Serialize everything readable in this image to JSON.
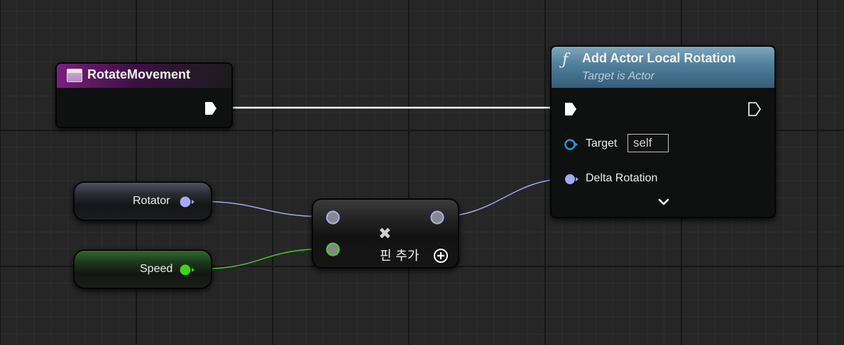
{
  "graph": {
    "background": "#262626",
    "event_node": {
      "title": "RotateMovement",
      "icon": "custom-event-icon",
      "header_color": "#7a1f7e"
    },
    "function_node": {
      "icon": "function-icon",
      "icon_glyph": "ƒ",
      "title": "Add Actor Local Rotation",
      "subtitle": "Target is Actor",
      "header_color": "#4f7d9a",
      "pins": {
        "target_label": "Target",
        "target_default": "self",
        "delta_label": "Delta Rotation"
      },
      "expand_icon": "chevron-down-icon"
    },
    "rotator_var": {
      "label": "Rotator",
      "pin_color": "#a3aaf2"
    },
    "speed_var": {
      "label": "Speed",
      "pin_color": "#3fd11a"
    },
    "multiply_node": {
      "icon": "multiply-icon",
      "icon_glyph": "✖",
      "add_pin_label": "핀 추가",
      "add_pin_icon": "plus-circle-icon"
    },
    "wire_colors": {
      "exec": "#ffffff",
      "rotator": "#a3aaf2",
      "float": "#3fd11a"
    }
  }
}
